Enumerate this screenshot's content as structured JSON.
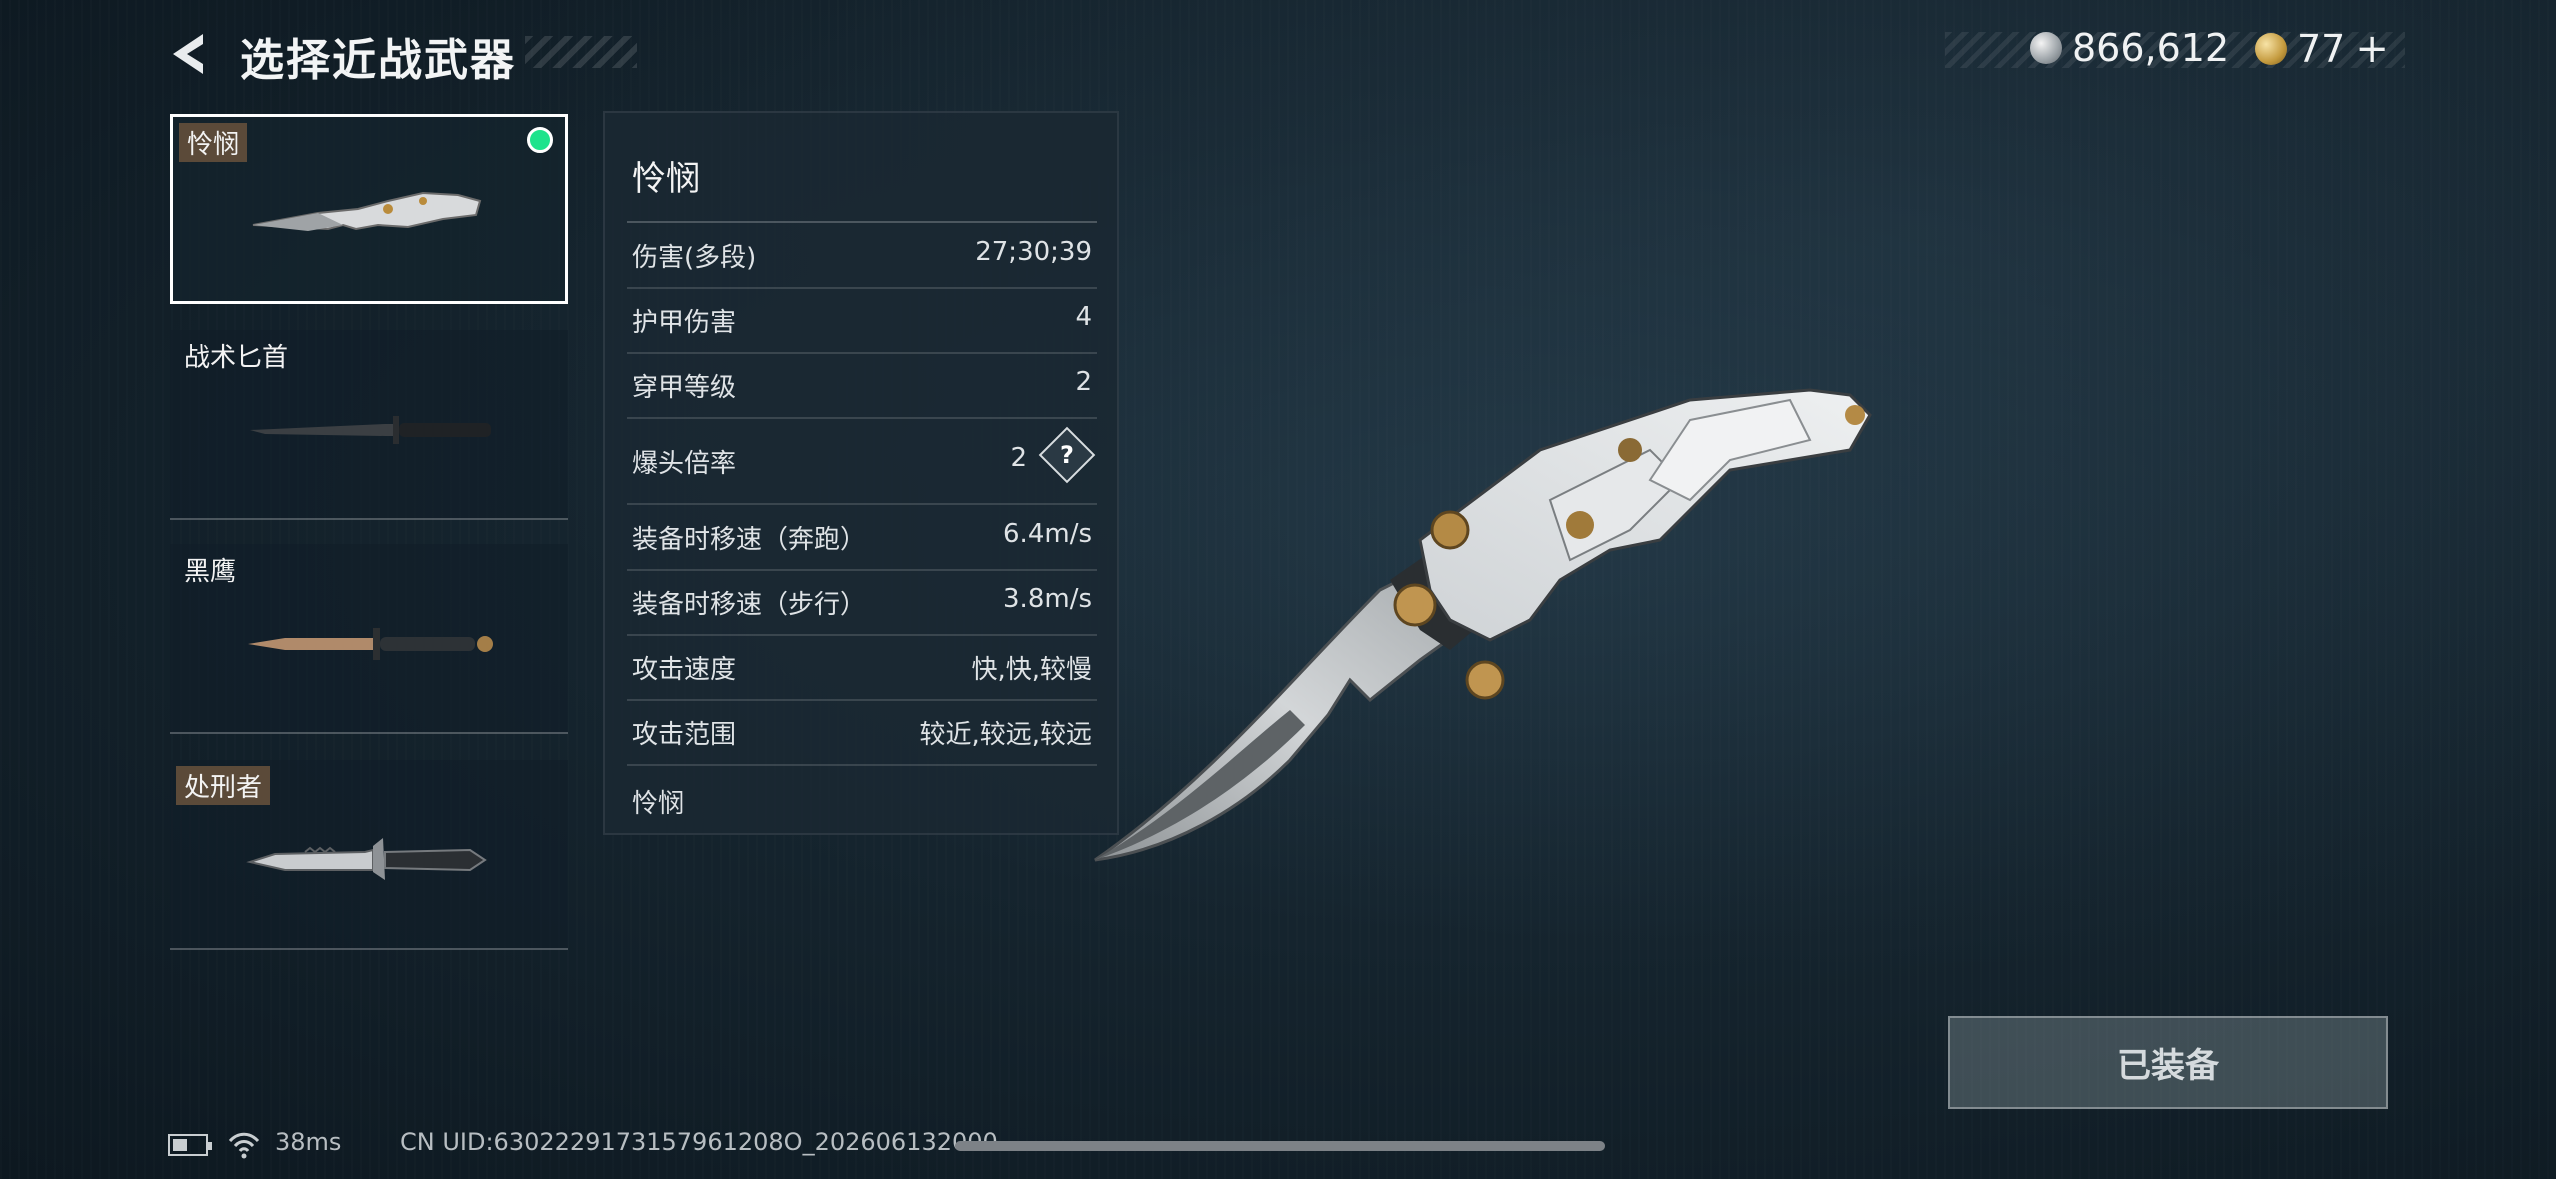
{
  "header": {
    "back_icon": "back-arrow-icon",
    "title": "选择近战武器",
    "currency_silver": "866,612",
    "currency_gold": "77",
    "add_symbol": "+"
  },
  "weapons": [
    {
      "name": "怜悯",
      "selected": true,
      "equipped_indicator": "green-dot"
    },
    {
      "name": "战术匕首",
      "selected": false
    },
    {
      "name": "黑鹰",
      "selected": false
    },
    {
      "name": "处刑者",
      "selected": false
    }
  ],
  "details": {
    "name": "怜悯",
    "stats": [
      {
        "label": "伤害(多段)",
        "value": "27;30;39"
      },
      {
        "label": "护甲伤害",
        "value": "4"
      },
      {
        "label": "穿甲等级",
        "value": "2"
      },
      {
        "label": "爆头倍率",
        "value": "2",
        "help": "?"
      },
      {
        "label": "装备时移速（奔跑）",
        "value": "6.4m/s"
      },
      {
        "label": "装备时移速（步行）",
        "value": "3.8m/s"
      },
      {
        "label": "攻击速度",
        "value": "快,快,较慢"
      },
      {
        "label": "攻击范围",
        "value": "较近,较远,较远"
      }
    ],
    "description": "怜悯"
  },
  "equip_button": "已装备",
  "status": {
    "ping": "38ms",
    "uid": "CN UID:6302229173157961208O_202606132000"
  },
  "colors": {
    "selected_border": "#ffffff",
    "equipped_dot": "#1de38c",
    "tag_background": "#5b4a39"
  }
}
